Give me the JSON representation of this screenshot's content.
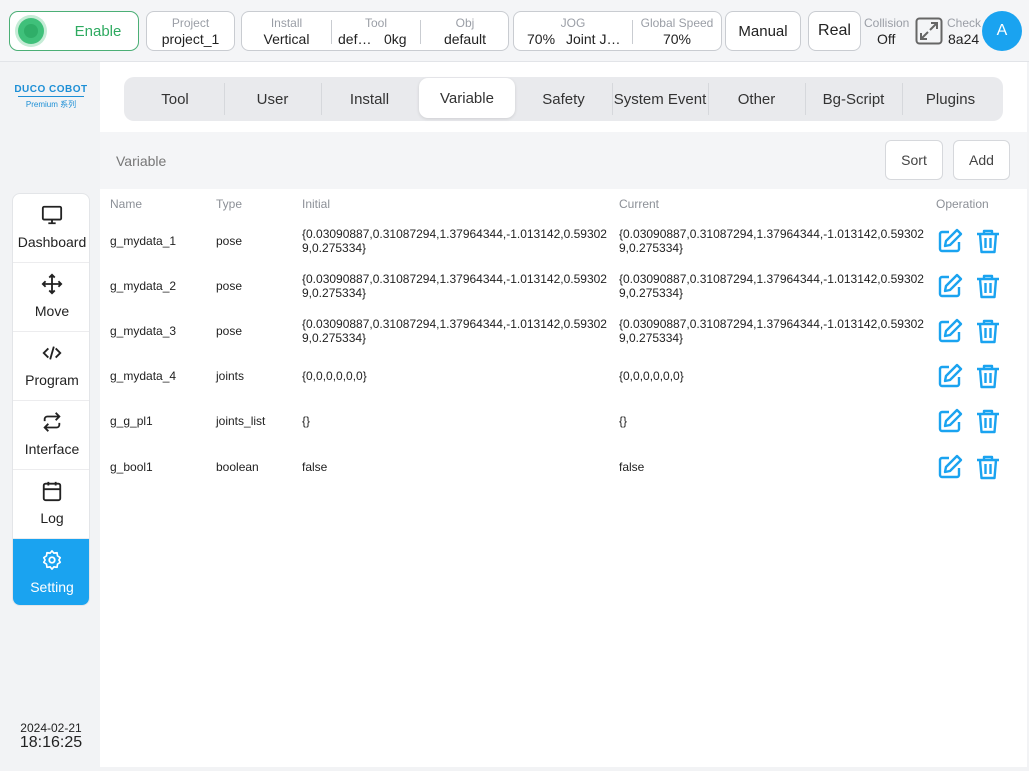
{
  "topbar": {
    "enable_label": "Enable",
    "project": {
      "label": "Project",
      "value": "project_1"
    },
    "install": {
      "label": "Install",
      "value": "Vertical"
    },
    "tool": {
      "label": "Tool",
      "value_name": "def…",
      "value_weight": "0kg"
    },
    "obj": {
      "label": "Obj",
      "value": "default"
    },
    "jog": {
      "label": "JOG",
      "value_speed": "70%",
      "value_mode": "Joint J…"
    },
    "global_speed": {
      "label": "Global Speed",
      "value": "70%"
    },
    "mode_button": "Manual",
    "real_button": "Real",
    "collision": {
      "label": "Collision",
      "value": "Off"
    },
    "check": {
      "label": "Check",
      "value": "8a24"
    },
    "avatar_letter": "A"
  },
  "logo": {
    "main": "DUCO COBOT",
    "sub": "Premium 系列"
  },
  "nav": {
    "items": [
      {
        "label": "Dashboard",
        "icon": "monitor-icon"
      },
      {
        "label": "Move",
        "icon": "move-arrows-icon"
      },
      {
        "label": "Program",
        "icon": "code-icon"
      },
      {
        "label": "Interface",
        "icon": "swap-arrows-icon"
      },
      {
        "label": "Log",
        "icon": "calendar-icon"
      },
      {
        "label": "Setting",
        "icon": "gear-icon"
      }
    ],
    "active": "Setting"
  },
  "datetime": {
    "date": "2024-02-21",
    "time": "18:16:25"
  },
  "tabs": [
    "Tool",
    "User",
    "Install",
    "Variable",
    "Safety",
    "System Event",
    "Other",
    "Bg-Script",
    "Plugins"
  ],
  "active_tab": "Variable",
  "variable_panel": {
    "title": "Variable",
    "sort_label": "Sort",
    "add_label": "Add"
  },
  "table": {
    "headers": {
      "name": "Name",
      "type": "Type",
      "initial": "Initial",
      "current": "Current",
      "operation": "Operation"
    },
    "rows": [
      {
        "name": "g_mydata_1",
        "type": "pose",
        "initial": "{0.03090887,0.31087294,1.37964344,-1.013142,0.593029,0.275334}",
        "current": "{0.03090887,0.31087294,1.37964344,-1.013142,0.593029,0.275334}"
      },
      {
        "name": "g_mydata_2",
        "type": "pose",
        "initial": "{0.03090887,0.31087294,1.37964344,-1.013142,0.593029,0.275334}",
        "current": "{0.03090887,0.31087294,1.37964344,-1.013142,0.593029,0.275334}"
      },
      {
        "name": "g_mydata_3",
        "type": "pose",
        "initial": "{0.03090887,0.31087294,1.37964344,-1.013142,0.593029,0.275334}",
        "current": "{0.03090887,0.31087294,1.37964344,-1.013142,0.593029,0.275334}"
      },
      {
        "name": "g_mydata_4",
        "type": "joints",
        "initial": "{0,0,0,0,0,0}",
        "current": "{0,0,0,0,0,0}"
      },
      {
        "name": "g_g_pl1",
        "type": "joints_list",
        "initial": "{}",
        "current": "{}"
      },
      {
        "name": "g_bool1",
        "type": "boolean",
        "initial": "false",
        "current": "false"
      }
    ]
  },
  "colors": {
    "accent": "#1aa3f0",
    "enable_green": "#2eaa60"
  }
}
